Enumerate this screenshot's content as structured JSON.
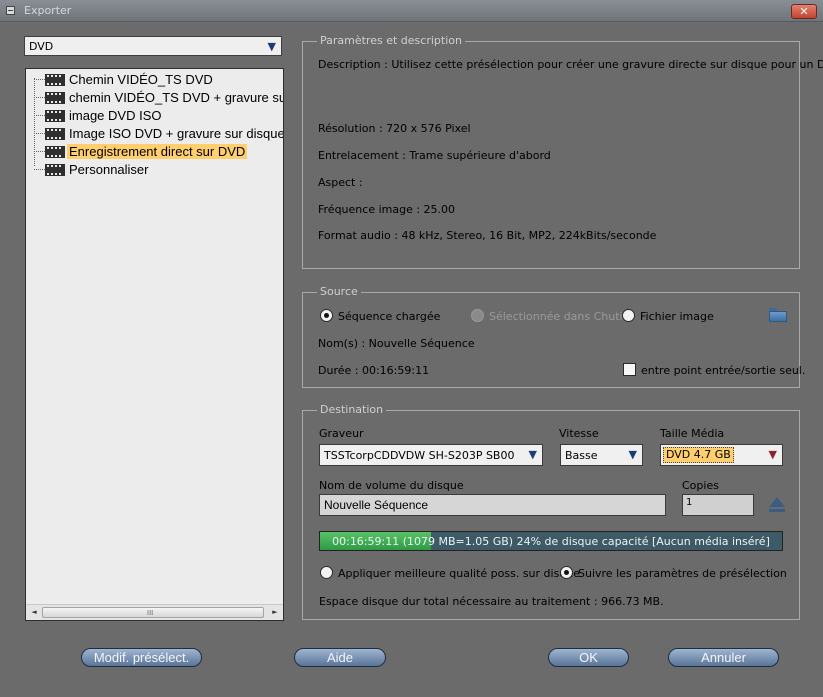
{
  "window": {
    "title": "Exporter",
    "close_glyph": "✕"
  },
  "preset_combo": {
    "value": "DVD",
    "arrow": "▼"
  },
  "tree": {
    "items": [
      {
        "label": "Chemin VIDÉO_TS DVD",
        "selected": false
      },
      {
        "label": "chemin VIDÉO_TS DVD + gravure sur disque",
        "selected": false
      },
      {
        "label": "image DVD ISO",
        "selected": false
      },
      {
        "label": "Image ISO DVD + gravure sur disque",
        "selected": false
      },
      {
        "label": "Enregistrement direct sur DVD",
        "selected": true
      },
      {
        "label": "Personnaliser",
        "selected": false
      }
    ],
    "scroll_left": "◄",
    "scroll_right": "►",
    "scroll_grip": "III"
  },
  "params": {
    "legend": "Paramètres et description",
    "description": "Description : Utilisez cette présélection pour créer une gravure directe sur disque pour un DVD",
    "resolution": "Résolution : 720 x 576 Pixel",
    "interlacing": "Entrelacement :  Trame supérieure d'abord",
    "aspect": "Aspect :",
    "framerate": "Fréquence image : 25.00",
    "audio": "Format audio : 48 kHz, Stereo, 16 Bit, MP2, 224kBits/seconde"
  },
  "source": {
    "legend": "Source",
    "radio_loaded": "Séquence chargée",
    "radio_chutier": "Sélectionnée dans Chutier",
    "radio_file": "Fichier image",
    "selected": "loaded",
    "names": "Nom(s) : Nouvelle Séquence",
    "duration": "Durée :   00:16:59:11",
    "in_out_only": "entre point entrée/sortie seul.",
    "in_out_checked": false
  },
  "destination": {
    "legend": "Destination",
    "burner_label": "Graveur",
    "burner_value": "TSSTcorpCDDVDW SH-S203P SB00",
    "speed_label": "Vitesse",
    "speed_value": "Basse",
    "media_label": "Taille Média",
    "media_value": "DVD 4.7 GB",
    "arrow": "▼",
    "volume_label": "Nom de volume du disque",
    "volume_value": "Nouvelle Séquence",
    "copies_label": "Copies",
    "copies_value": "1",
    "progress_text": "00:16:59:11 (1079 MB=1.05 GB) 24% de disque capacité [Aucun média inséré]",
    "progress_fraction": 0.24,
    "radio_best": "Appliquer meilleure qualité poss. sur disque",
    "radio_preset": "Suivre les paramètres de présélection",
    "quality_selected": "preset",
    "space": "Espace  disque dur total nécessaire au traitement : 966.73 MB."
  },
  "buttons": {
    "modify": "Modif. présélect.",
    "help": "Aide",
    "ok": "OK",
    "cancel": "Annuler"
  },
  "colors": {
    "selection": "#ffcf6e",
    "progress_fill": "#3fae55",
    "progress_bg": "#3e5a66",
    "button": "#7b94b6"
  }
}
